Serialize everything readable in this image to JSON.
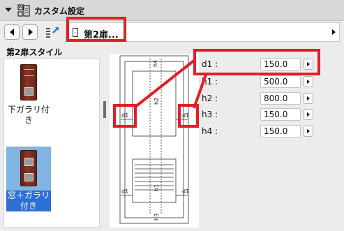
{
  "header": {
    "title": "カスタム設定",
    "icon": "door-settings-icon"
  },
  "navbar": {
    "path_text": "第2扉..."
  },
  "section": {
    "title": "第2扉スタイル"
  },
  "styles": [
    {
      "label": "下ガラリ付き",
      "selected": false
    },
    {
      "label": "窓＋ガラリ付き",
      "selected": true
    }
  ],
  "diagram_labels": {
    "h4": "h4",
    "h2": "h2",
    "h1": "h1",
    "h3": "h3",
    "d1": "d1"
  },
  "params": [
    {
      "label": "d1 :",
      "value": "150.0"
    },
    {
      "label": "h1 :",
      "value": "500.0"
    },
    {
      "label": "h2 :",
      "value": "800.0"
    },
    {
      "label": "h3 :",
      "value": "150.0"
    },
    {
      "label": "h4 :",
      "value": "150.0"
    }
  ],
  "colors": {
    "highlight": "#e21f26",
    "selection": "#2d6fd2",
    "door": "#6b2516"
  }
}
